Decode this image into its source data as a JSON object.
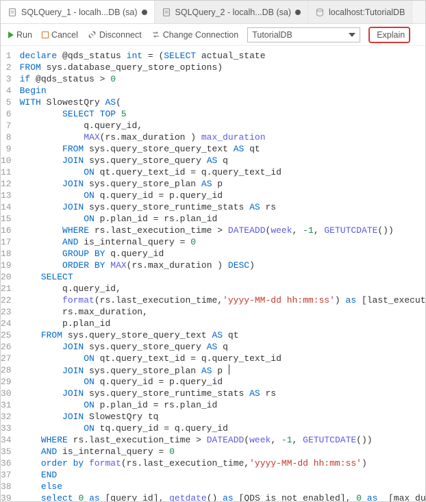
{
  "tabs": [
    {
      "label": "SQLQuery_1 - localh...DB (sa)",
      "dirty": true,
      "active": true
    },
    {
      "label": "SQLQuery_2 - localh...DB (sa)",
      "dirty": true,
      "active": false
    },
    {
      "label": "localhost:TutorialDB",
      "dirty": false,
      "active": false
    }
  ],
  "toolbar": {
    "run": "Run",
    "cancel": "Cancel",
    "disconnect": "Disconnect",
    "changeConnection": "Change Connection",
    "dbSelected": "TutorialDB",
    "explain": "Explain"
  },
  "code": {
    "lines": [
      {
        "n": 1,
        "indent": 0,
        "tokens": [
          [
            "kw",
            "declare"
          ],
          [
            "var",
            " @qds_status "
          ],
          [
            "kw",
            "int"
          ],
          [
            "var",
            " = ("
          ],
          [
            "kw",
            "SELECT"
          ],
          [
            "var",
            " actual_state"
          ]
        ]
      },
      {
        "n": 2,
        "indent": 0,
        "tokens": [
          [
            "kw",
            "FROM"
          ],
          [
            "var",
            " sys.database_query_store_options)"
          ]
        ]
      },
      {
        "n": 3,
        "indent": 0,
        "tokens": [
          [
            "kw",
            "if"
          ],
          [
            "var",
            " @qds_status > "
          ],
          [
            "num",
            "0"
          ]
        ]
      },
      {
        "n": 4,
        "indent": 0,
        "tokens": [
          [
            "kw",
            "Begin"
          ]
        ]
      },
      {
        "n": 5,
        "indent": 0,
        "tokens": [
          [
            "kw",
            "WITH"
          ],
          [
            "var",
            " SlowestQry "
          ],
          [
            "kw",
            "AS"
          ],
          [
            "var",
            "("
          ]
        ]
      },
      {
        "n": 6,
        "indent": 2,
        "tokens": [
          [
            "kw",
            "SELECT TOP"
          ],
          [
            "var",
            " "
          ],
          [
            "num",
            "5"
          ]
        ]
      },
      {
        "n": 7,
        "indent": 3,
        "tokens": [
          [
            "var",
            "q.query_id,"
          ]
        ]
      },
      {
        "n": 8,
        "indent": 3,
        "tokens": [
          [
            "fn",
            "MAX"
          ],
          [
            "var",
            "(rs.max_duration ) "
          ],
          [
            "fn",
            "max_duration"
          ]
        ]
      },
      {
        "n": 9,
        "indent": 2,
        "tokens": [
          [
            "kw",
            "FROM"
          ],
          [
            "var",
            " sys.query_store_query_text "
          ],
          [
            "kw",
            "AS"
          ],
          [
            "var",
            " qt"
          ]
        ]
      },
      {
        "n": 10,
        "indent": 2,
        "tokens": [
          [
            "kw",
            "JOIN"
          ],
          [
            "var",
            " sys.query_store_query "
          ],
          [
            "kw",
            "AS"
          ],
          [
            "var",
            " q"
          ]
        ]
      },
      {
        "n": 11,
        "indent": 3,
        "tokens": [
          [
            "kw",
            "ON"
          ],
          [
            "var",
            " qt.query_text_id = q.query_text_id"
          ]
        ]
      },
      {
        "n": 12,
        "indent": 2,
        "tokens": [
          [
            "kw",
            "JOIN"
          ],
          [
            "var",
            " sys.query_store_plan "
          ],
          [
            "kw",
            "AS"
          ],
          [
            "var",
            " p"
          ]
        ]
      },
      {
        "n": 13,
        "indent": 3,
        "tokens": [
          [
            "kw",
            "ON"
          ],
          [
            "var",
            " q.query_id = p.query_id"
          ]
        ]
      },
      {
        "n": 14,
        "indent": 2,
        "tokens": [
          [
            "kw",
            "JOIN"
          ],
          [
            "var",
            " sys.query_store_runtime_stats "
          ],
          [
            "kw",
            "AS"
          ],
          [
            "var",
            " rs"
          ]
        ]
      },
      {
        "n": 15,
        "indent": 3,
        "tokens": [
          [
            "kw",
            "ON"
          ],
          [
            "var",
            " p.plan_id = rs.plan_id"
          ]
        ]
      },
      {
        "n": 16,
        "indent": 2,
        "tokens": [
          [
            "kw",
            "WHERE"
          ],
          [
            "var",
            " rs.last_execution_time > "
          ],
          [
            "fn",
            "DATEADD"
          ],
          [
            "var",
            "("
          ],
          [
            "fn",
            "week"
          ],
          [
            "var",
            ", "
          ],
          [
            "num",
            "-1"
          ],
          [
            "var",
            ", "
          ],
          [
            "fn",
            "GETUTCDATE"
          ],
          [
            "var",
            "())"
          ]
        ]
      },
      {
        "n": 17,
        "indent": 2,
        "tokens": [
          [
            "kw",
            "AND"
          ],
          [
            "var",
            " is_internal_query = "
          ],
          [
            "num",
            "0"
          ]
        ]
      },
      {
        "n": 18,
        "indent": 2,
        "tokens": [
          [
            "kw",
            "GROUP BY"
          ],
          [
            "var",
            " q.query_id"
          ]
        ]
      },
      {
        "n": 19,
        "indent": 2,
        "tokens": [
          [
            "kw",
            "ORDER BY"
          ],
          [
            "var",
            " "
          ],
          [
            "fn",
            "MAX"
          ],
          [
            "var",
            "(rs.max_duration ) "
          ],
          [
            "kw",
            "DESC"
          ],
          [
            "var",
            ")"
          ]
        ]
      },
      {
        "n": 20,
        "indent": 1,
        "tokens": [
          [
            "kw",
            "SELECT"
          ]
        ]
      },
      {
        "n": 21,
        "indent": 2,
        "tokens": [
          [
            "var",
            "q.query_id,"
          ]
        ]
      },
      {
        "n": 22,
        "indent": 2,
        "tokens": [
          [
            "fn",
            "format"
          ],
          [
            "var",
            "(rs.last_execution_time,"
          ],
          [
            "str",
            "'yyyy-MM-dd hh:mm:ss'"
          ],
          [
            "var",
            ") "
          ],
          [
            "kw",
            "as"
          ],
          [
            "var",
            " [last_execution_time],"
          ]
        ]
      },
      {
        "n": 23,
        "indent": 2,
        "tokens": [
          [
            "var",
            "rs.max_duration,"
          ]
        ]
      },
      {
        "n": 24,
        "indent": 2,
        "tokens": [
          [
            "var",
            "p.plan_id"
          ]
        ]
      },
      {
        "n": 25,
        "indent": 1,
        "tokens": [
          [
            "kw",
            "FROM"
          ],
          [
            "var",
            " sys.query_store_query_text "
          ],
          [
            "kw",
            "AS"
          ],
          [
            "var",
            " qt"
          ]
        ]
      },
      {
        "n": 26,
        "indent": 2,
        "tokens": [
          [
            "kw",
            "JOIN"
          ],
          [
            "var",
            " sys.query_store_query "
          ],
          [
            "kw",
            "AS"
          ],
          [
            "var",
            " q"
          ]
        ]
      },
      {
        "n": 27,
        "indent": 3,
        "tokens": [
          [
            "kw",
            "ON"
          ],
          [
            "var",
            " qt.query_text_id = q.query_text_id"
          ]
        ]
      },
      {
        "n": 28,
        "indent": 2,
        "tokens": [
          [
            "kw",
            "JOIN"
          ],
          [
            "var",
            " sys.query_store_plan "
          ],
          [
            "kw",
            "AS"
          ],
          [
            "var",
            " p"
          ]
        ],
        "cursor": true
      },
      {
        "n": 29,
        "indent": 3,
        "tokens": [
          [
            "kw",
            "ON"
          ],
          [
            "var",
            " q.query_id = p.query_id"
          ]
        ]
      },
      {
        "n": 30,
        "indent": 2,
        "tokens": [
          [
            "kw",
            "JOIN"
          ],
          [
            "var",
            " sys.query_store_runtime_stats "
          ],
          [
            "kw",
            "AS"
          ],
          [
            "var",
            " rs"
          ]
        ]
      },
      {
        "n": 31,
        "indent": 3,
        "tokens": [
          [
            "kw",
            "ON"
          ],
          [
            "var",
            " p.plan_id = rs.plan_id"
          ]
        ]
      },
      {
        "n": 32,
        "indent": 2,
        "tokens": [
          [
            "kw",
            "JOIN"
          ],
          [
            "var",
            " SlowestQry tq"
          ]
        ]
      },
      {
        "n": 33,
        "indent": 3,
        "tokens": [
          [
            "kw",
            "ON"
          ],
          [
            "var",
            " tq.query_id = q.query_id"
          ]
        ]
      },
      {
        "n": 34,
        "indent": 1,
        "tokens": [
          [
            "kw",
            "WHERE"
          ],
          [
            "var",
            " rs.last_execution_time > "
          ],
          [
            "fn",
            "DATEADD"
          ],
          [
            "var",
            "("
          ],
          [
            "fn",
            "week"
          ],
          [
            "var",
            ", "
          ],
          [
            "num",
            "-1"
          ],
          [
            "var",
            ", "
          ],
          [
            "fn",
            "GETUTCDATE"
          ],
          [
            "var",
            "())"
          ]
        ]
      },
      {
        "n": 35,
        "indent": 1,
        "tokens": [
          [
            "kw",
            "AND"
          ],
          [
            "var",
            " is_internal_query = "
          ],
          [
            "num",
            "0"
          ]
        ]
      },
      {
        "n": 36,
        "indent": 1,
        "tokens": [
          [
            "kw",
            "order by"
          ],
          [
            "var",
            " "
          ],
          [
            "fn",
            "format"
          ],
          [
            "var",
            "(rs.last_execution_time,"
          ],
          [
            "str",
            "'yyyy-MM-dd hh:mm:ss'"
          ],
          [
            "var",
            ")"
          ]
        ]
      },
      {
        "n": 37,
        "indent": 1,
        "tokens": [
          [
            "kw",
            "END"
          ]
        ]
      },
      {
        "n": 38,
        "indent": 1,
        "tokens": [
          [
            "kw",
            "else"
          ]
        ]
      },
      {
        "n": 39,
        "indent": 1,
        "tokens": [
          [
            "kw",
            "select"
          ],
          [
            "var",
            " "
          ],
          [
            "num",
            "0"
          ],
          [
            "var",
            " "
          ],
          [
            "kw",
            "as"
          ],
          [
            "var",
            " [query_id], "
          ],
          [
            "fn",
            "getdate"
          ],
          [
            "var",
            "() "
          ],
          [
            "kw",
            "as"
          ],
          [
            "var",
            " [QDS is not enabled], "
          ],
          [
            "num",
            "0"
          ],
          [
            "var",
            " "
          ],
          [
            "kw",
            "as"
          ],
          [
            "var",
            "  [max_duration]"
          ]
        ]
      }
    ]
  }
}
